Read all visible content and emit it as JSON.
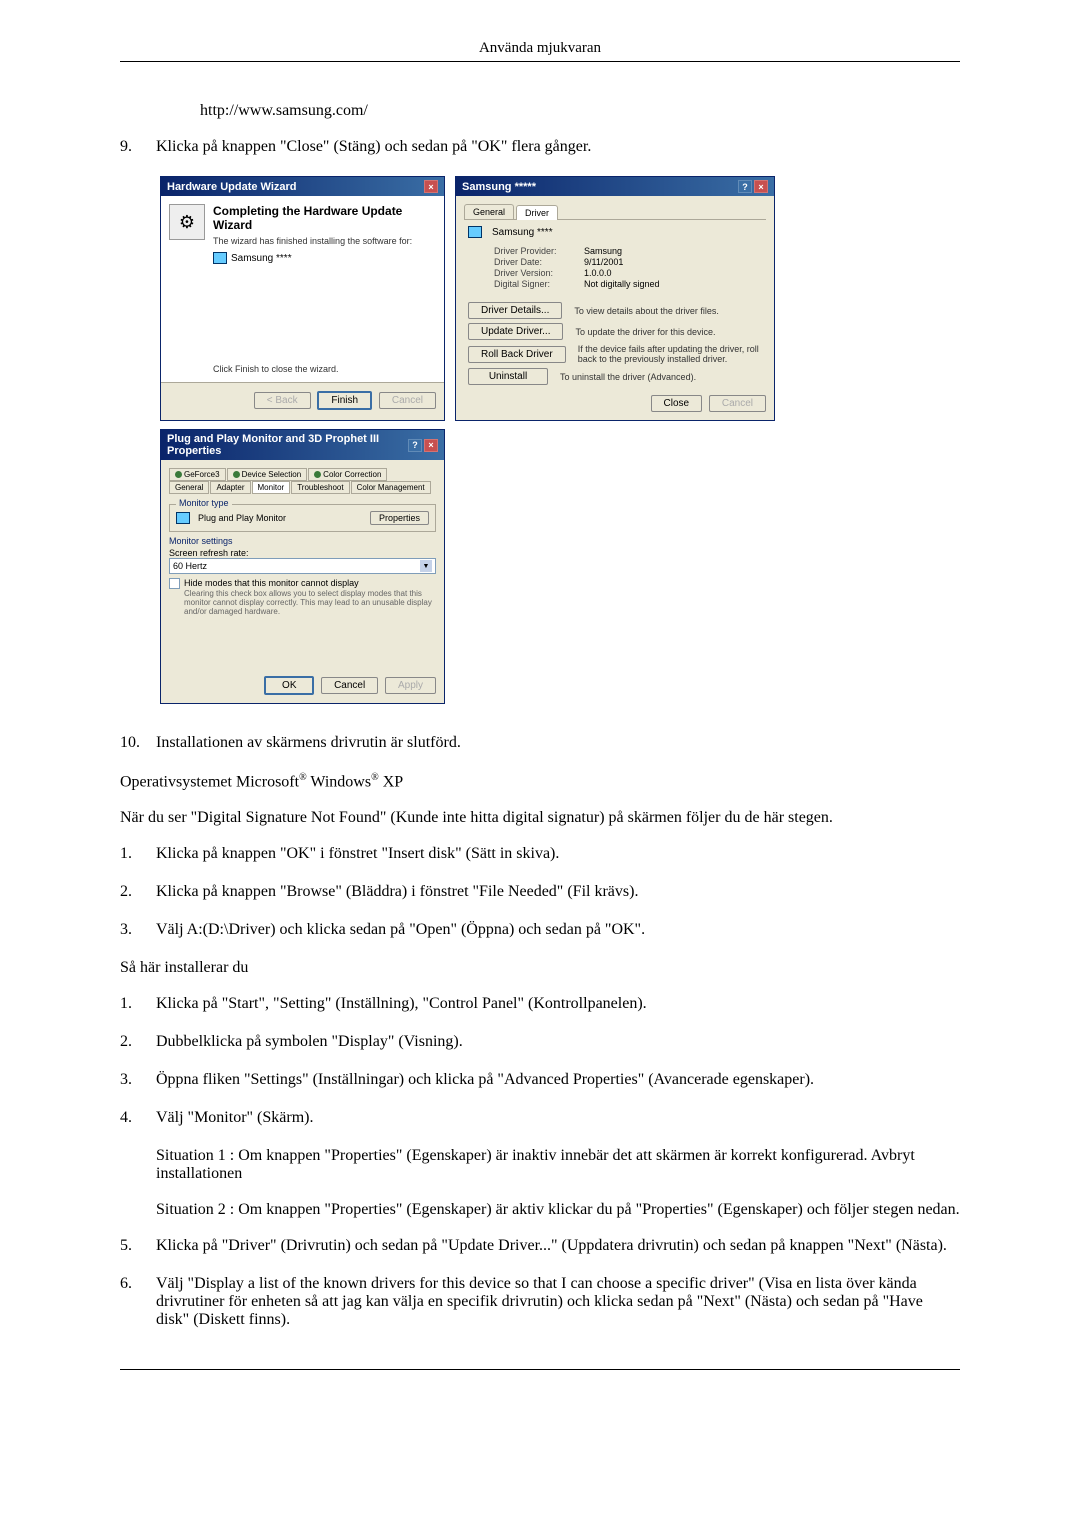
{
  "page_header": "Använda mjukvaran",
  "url": "http://www.samsung.com/",
  "step9_num": "9.",
  "step9_text": "Klicka på knappen \"Close\" (Stäng) och sedan på \"OK\" flera gånger.",
  "step10_num": "10.",
  "step10_text": "Installationen av skärmens drivrutin är slutförd.",
  "os_prefix": "Operativsystemet Microsoft",
  "os_mid": " Windows",
  "os_suffix": " XP",
  "reg": "®",
  "dsnf_text": "När du ser \"Digital Signature Not Found\" (Kunde inte hitta digital signatur) på skärmen följer du de här stegen.",
  "listA": [
    {
      "num": "1.",
      "text": "Klicka på knappen \"OK\" i fönstret \"Insert disk\" (Sätt in skiva)."
    },
    {
      "num": "2.",
      "text": "Klicka på knappen \"Browse\" (Bläddra) i fönstret \"File Needed\" (Fil krävs)."
    },
    {
      "num": "3.",
      "text": "Välj A:(D:\\Driver) och klicka sedan på \"Open\" (Öppna) och sedan på \"OK\"."
    }
  ],
  "install_heading": "Så här installerar du",
  "listB": [
    {
      "num": "1.",
      "text": "Klicka på \"Start\", \"Setting\" (Inställning), \"Control Panel\" (Kontrollpanelen)."
    },
    {
      "num": "2.",
      "text": "Dubbelklicka på symbolen \"Display\" (Visning)."
    },
    {
      "num": "3.",
      "text": "Öppna fliken \"Settings\" (Inställningar) och klicka på \"Advanced Properties\" (Avancerade egenskaper)."
    },
    {
      "num": "4.",
      "text": "Välj \"Monitor\" (Skärm)."
    }
  ],
  "situation1": "Situation 1 : Om knappen \"Properties\" (Egenskaper) är inaktiv innebär det att skärmen är korrekt konfigurerad. Avbryt installationen",
  "situation2": "Situation 2 : Om knappen \"Properties\" (Egenskaper) är aktiv klickar du på \"Properties\" (Egenskaper) och följer stegen nedan.",
  "listC": [
    {
      "num": "5.",
      "text": "Klicka på \"Driver\" (Drivrutin) och sedan på \"Update Driver...\" (Uppdatera drivrutin) och sedan på knappen \"Next\" (Nästa)."
    },
    {
      "num": "6.",
      "text": "Välj \"Display a list of the known drivers for this device so that I can choose a specific driver\" (Visa en lista över kända drivrutiner för enheten så att jag kan välja en specifik drivrutin) och klicka sedan på \"Next\" (Nästa) och sedan på \"Have disk\" (Diskett finns)."
    }
  ],
  "dialog1": {
    "title": "Hardware Update Wizard",
    "heading": "Completing the Hardware Update Wizard",
    "sub": "The wizard has finished installing the software for:",
    "device": "Samsung ****",
    "finish_text": "Click Finish to close the wizard.",
    "btn_back": "< Back",
    "btn_finish": "Finish",
    "btn_cancel": "Cancel"
  },
  "dialog2": {
    "title": "Samsung *****",
    "tab_general": "General",
    "tab_driver": "Driver",
    "device": "Samsung ****",
    "rows": [
      {
        "k": "Driver Provider:",
        "v": "Samsung"
      },
      {
        "k": "Driver Date:",
        "v": "9/11/2001"
      },
      {
        "k": "Driver Version:",
        "v": "1.0.0.0"
      },
      {
        "k": "Digital Signer:",
        "v": "Not digitally signed"
      }
    ],
    "btns": [
      {
        "label": "Driver Details...",
        "desc": "To view details about the driver files."
      },
      {
        "label": "Update Driver...",
        "desc": "To update the driver for this device."
      },
      {
        "label": "Roll Back Driver",
        "desc": "If the device fails after updating the driver, roll back to the previously installed driver."
      },
      {
        "label": "Uninstall",
        "desc": "To uninstall the driver (Advanced)."
      }
    ],
    "btn_close": "Close",
    "btn_cancel": "Cancel"
  },
  "dialog3": {
    "title": "Plug and Play Monitor and 3D Prophet III Properties",
    "tabs_row1": [
      "GeForce3",
      "Device Selection",
      "Color Correction"
    ],
    "tabs_row2": [
      "General",
      "Adapter",
      "Monitor",
      "Troubleshoot",
      "Color Management"
    ],
    "group1": "Monitor type",
    "monitor_name": "Plug and Play Monitor",
    "btn_properties": "Properties",
    "group2": "Monitor settings",
    "refresh_label": "Screen refresh rate:",
    "refresh_value": "60 Hertz",
    "hide_modes": "Hide modes that this monitor cannot display",
    "hide_note": "Clearing this check box allows you to select display modes that this monitor cannot display correctly. This may lead to an unusable display and/or damaged hardware.",
    "btn_ok": "OK",
    "btn_cancel": "Cancel",
    "btn_apply": "Apply"
  }
}
